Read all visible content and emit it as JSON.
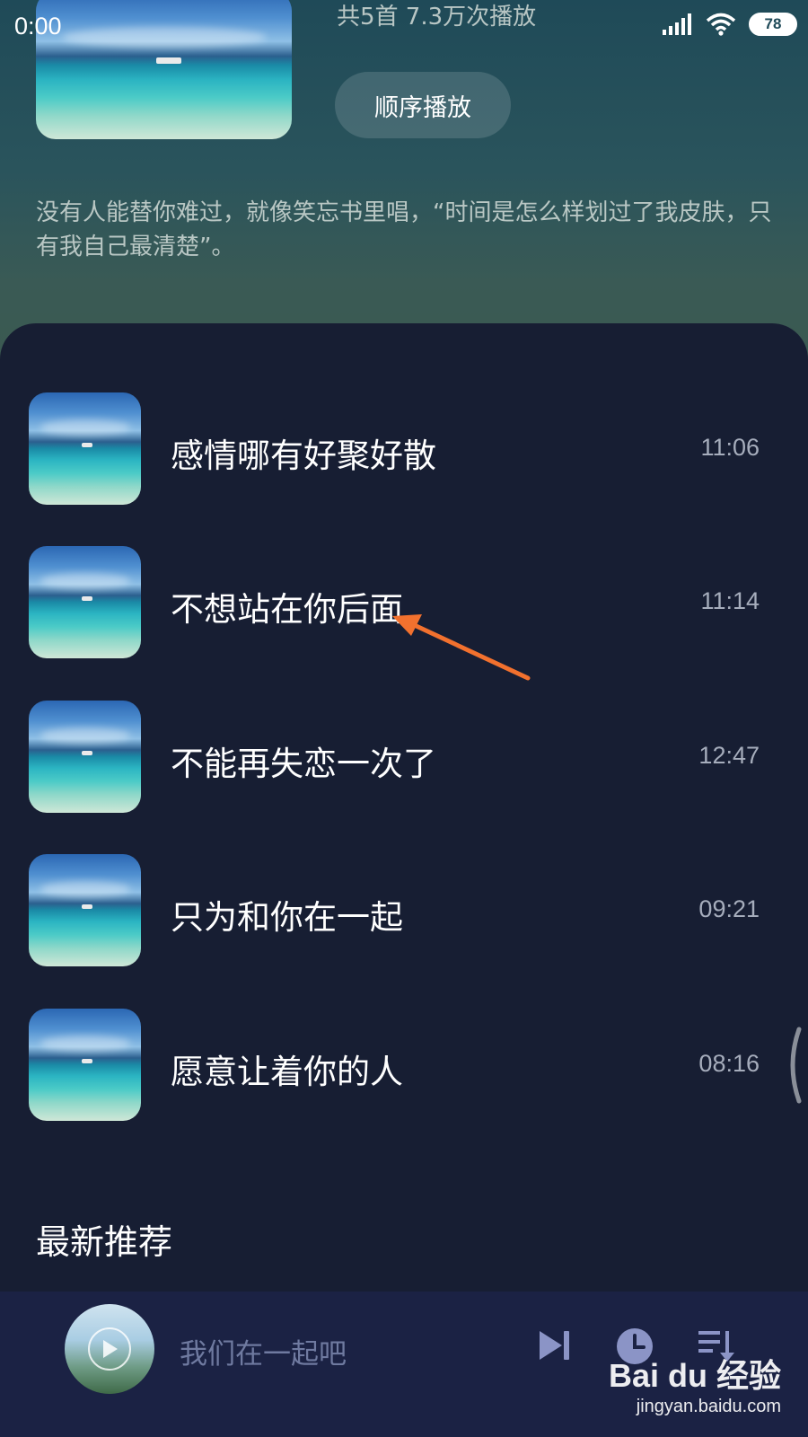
{
  "status_bar": {
    "time": "0:00",
    "battery": "78",
    "icons": [
      "signal-icon",
      "wifi-icon",
      "battery-icon"
    ]
  },
  "header": {
    "stats": "共5首   7.3万次播放",
    "order_play_label": "顺序播放",
    "description": "没有人能替你难过，就像笑忘书里唱，“时间是怎么样划过了我皮肤，只有我自己最清楚”。"
  },
  "songs": [
    {
      "title": "感情哪有好聚好散",
      "duration": "11:06"
    },
    {
      "title": "不想站在你后面",
      "duration": "11:14"
    },
    {
      "title": "不能再失恋一次了",
      "duration": "12:47"
    },
    {
      "title": "只为和你在一起",
      "duration": "09:21"
    },
    {
      "title": "愿意让着你的人",
      "duration": "08:16"
    }
  ],
  "section": {
    "title": "最新推荐"
  },
  "mini_player": {
    "title": "我们在一起吧",
    "icons": [
      "play-icon",
      "next-track-icon",
      "timer-icon",
      "playlist-icon"
    ]
  },
  "watermark": {
    "logo": "Bai du 经验",
    "url": "jingyan.baidu.com"
  },
  "colors": {
    "background": "#171e33",
    "mini_player_bg": "#1b2244",
    "accent_icon": "#8b94c6",
    "annotation_arrow": "#f2712e"
  }
}
